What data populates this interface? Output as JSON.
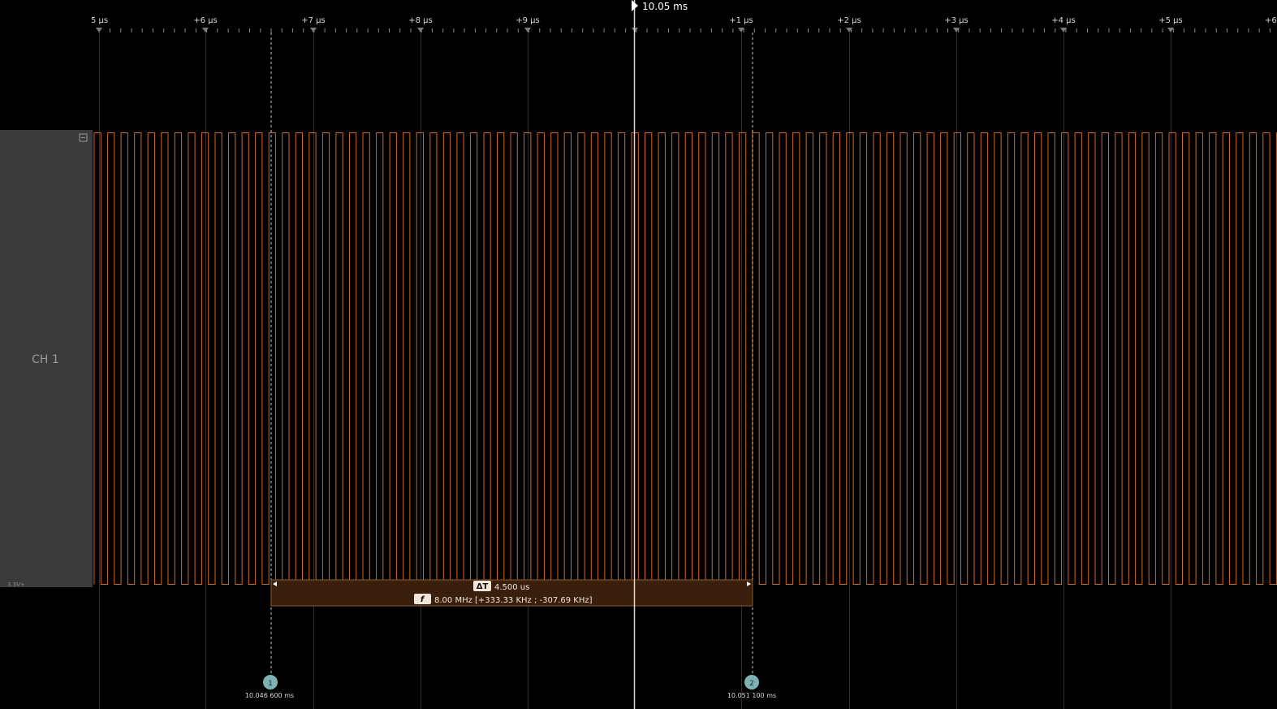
{
  "colors": {
    "background": "#000000",
    "signal": "#d2691e",
    "grid": "#2f2f2f",
    "channel_panel": "#3a3a3a",
    "measurement_fill": "#3a1f0c",
    "marker": "#7fb3b3"
  },
  "timeline": {
    "cursor_label": "10.05 ms",
    "ticks": [
      "5 µs",
      "+6 µs",
      "+7 µs",
      "+8 µs",
      "+9 µs",
      "+1 µs",
      "+2 µs",
      "+3 µs",
      "+4 µs",
      "+5 µs",
      "+6"
    ]
  },
  "channel": {
    "name": "CH 1",
    "voltage_label": "3.3V+",
    "collapse_icon": "minus-box-icon"
  },
  "measurement": {
    "delta_badge": "ΔT",
    "delta_value": "4.500 us",
    "freq_badge": "f",
    "freq_value": "8.00 MHz [+333.33 KHz ; -307.69 KHz]"
  },
  "markers": [
    {
      "number": "1",
      "time": "10.046 600 ms"
    },
    {
      "number": "2",
      "time": "10.051 100 ms"
    }
  ]
}
